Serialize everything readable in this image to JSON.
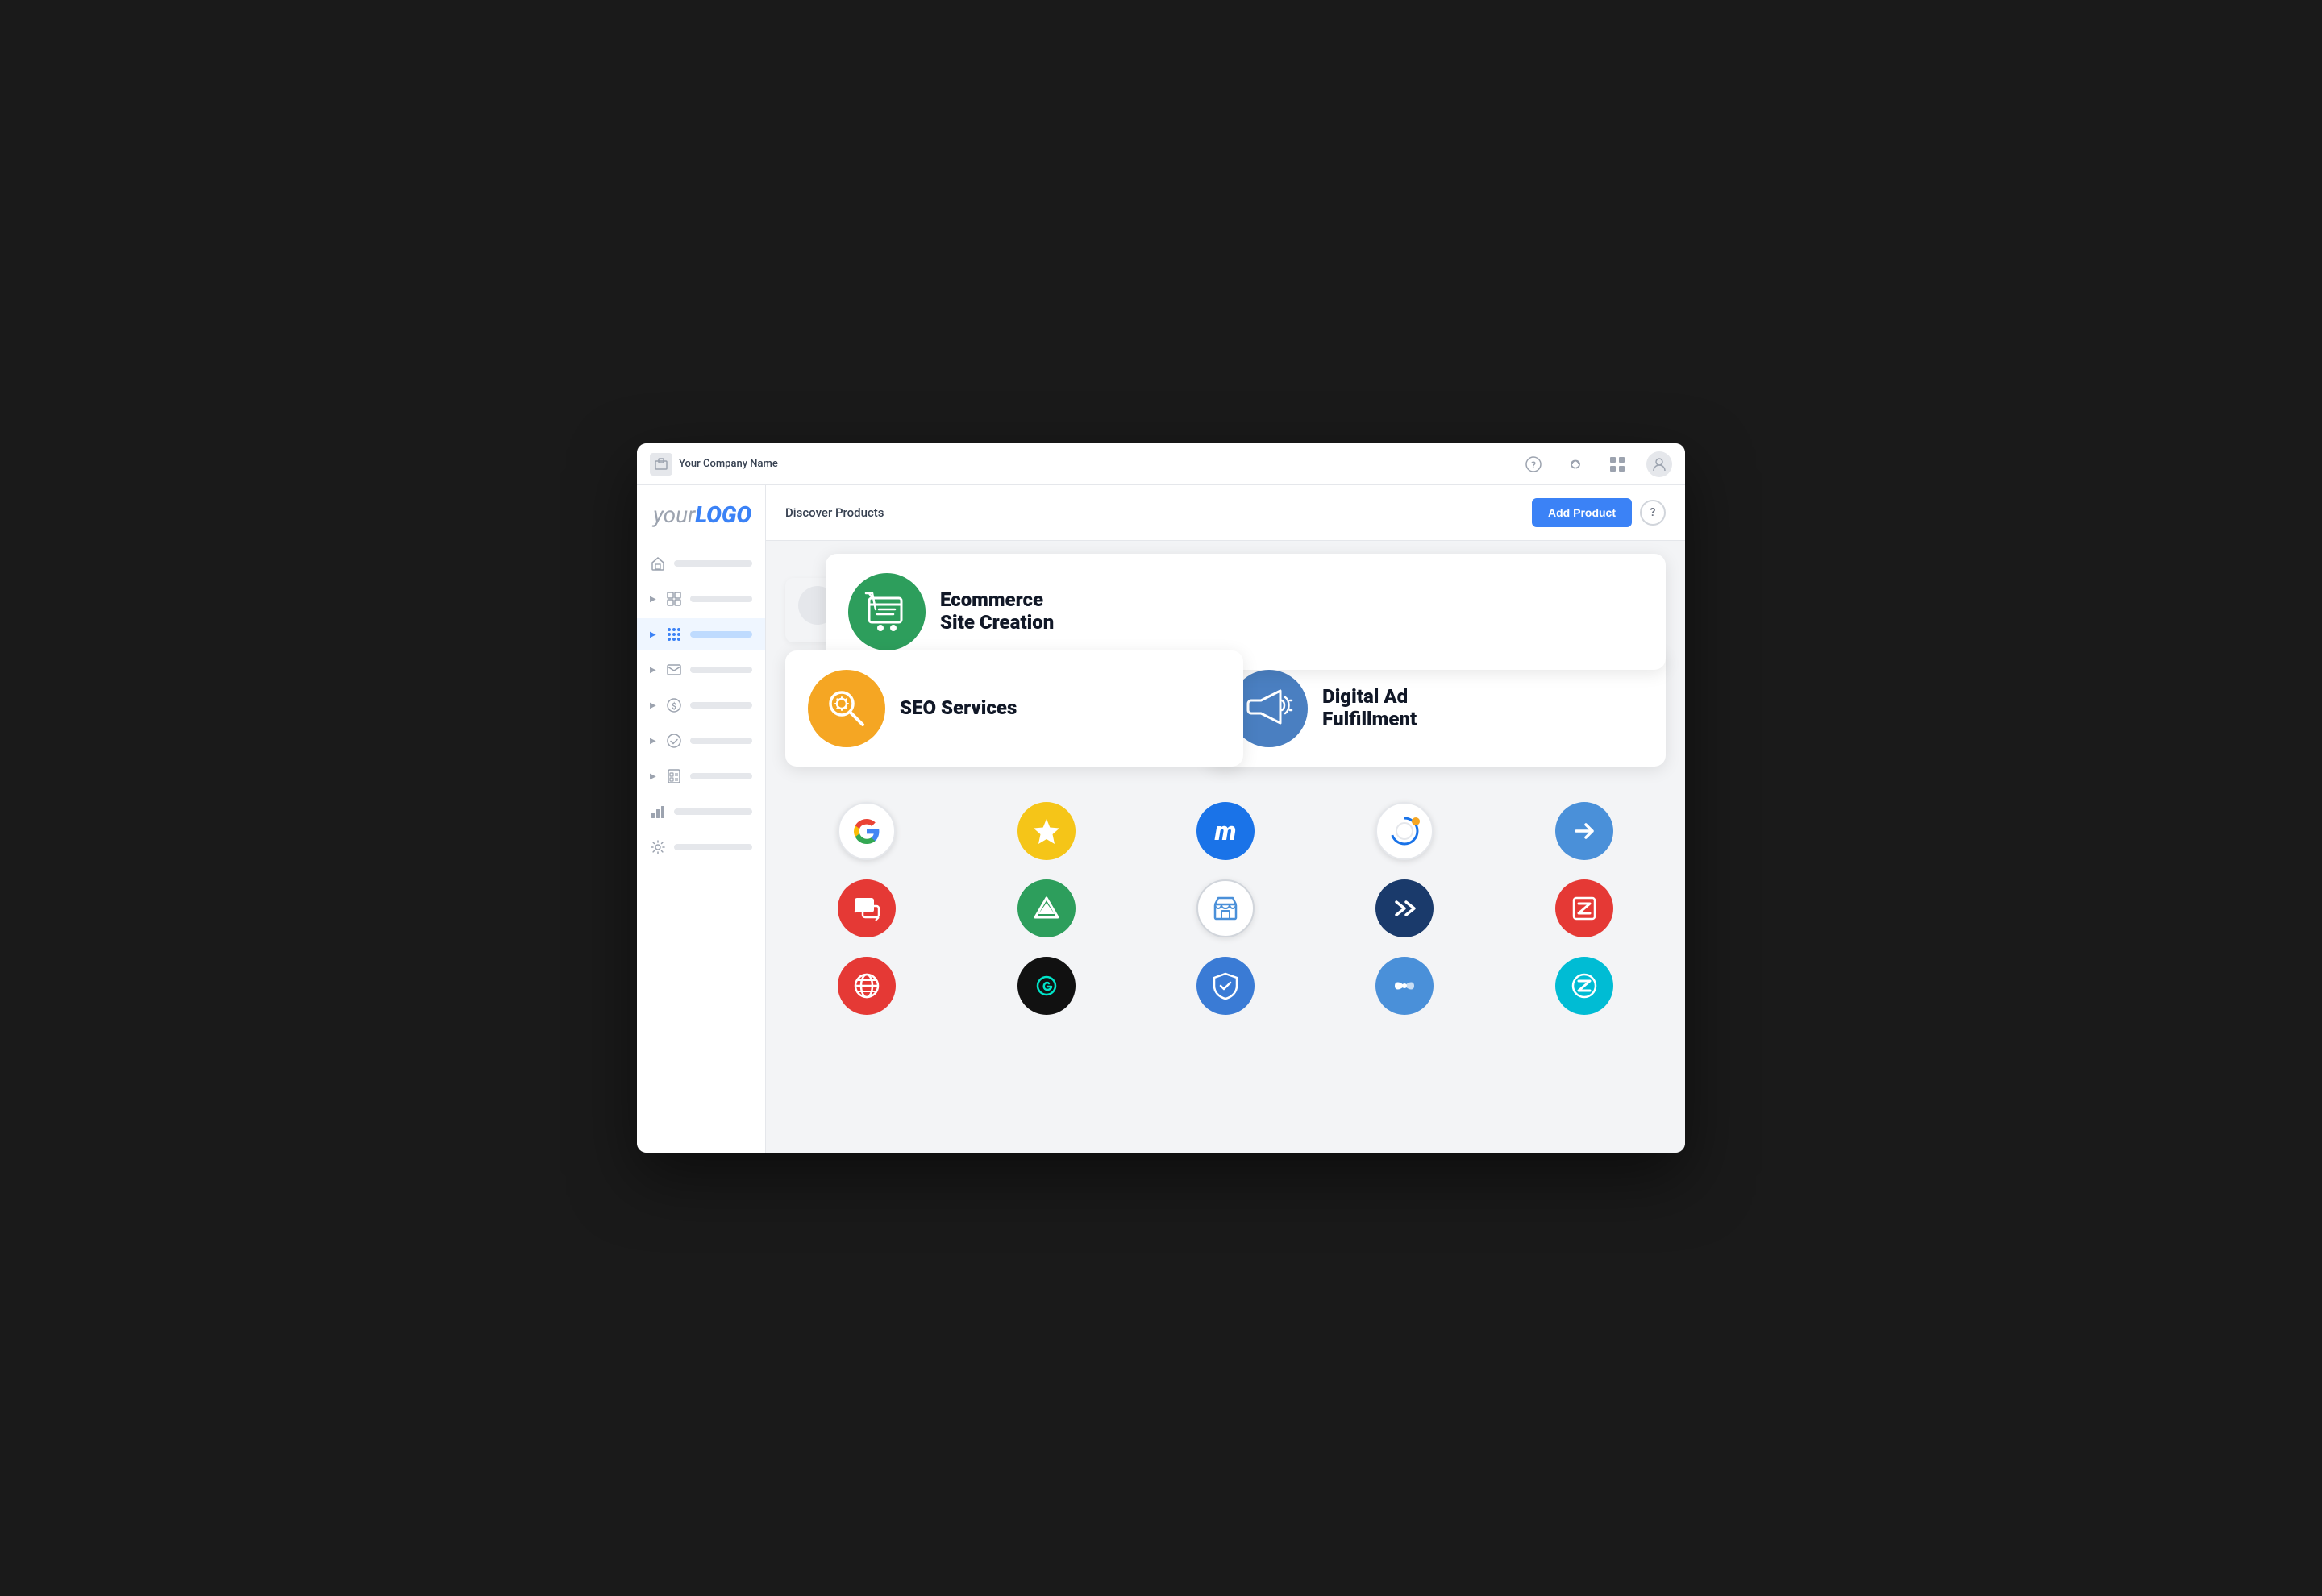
{
  "topBar": {
    "companyName": "Your Company Name",
    "companyIconSymbol": "🏢",
    "icons": {
      "help": "?",
      "infinity": "∞",
      "grid": "⠿",
      "user": "👤"
    }
  },
  "sidebar": {
    "logo": {
      "your": "your",
      "logo": "LOGO"
    },
    "items": [
      {
        "id": "home",
        "icon": "🏠",
        "hasArrow": false,
        "active": false
      },
      {
        "id": "grid1",
        "icon": "⊞",
        "hasArrow": true,
        "active": false
      },
      {
        "id": "apps",
        "icon": "⠿",
        "hasArrow": true,
        "active": true
      },
      {
        "id": "mail",
        "icon": "✉",
        "hasArrow": true,
        "active": false
      },
      {
        "id": "dollar",
        "icon": "$",
        "hasArrow": true,
        "active": false
      },
      {
        "id": "check",
        "icon": "✓",
        "hasArrow": true,
        "active": false
      },
      {
        "id": "report",
        "icon": "▦",
        "hasArrow": true,
        "active": false
      },
      {
        "id": "chart",
        "icon": "📊",
        "hasArrow": false,
        "active": false
      },
      {
        "id": "settings",
        "icon": "⚙",
        "hasArrow": false,
        "active": false
      }
    ]
  },
  "header": {
    "discoverLabel": "Discover Products",
    "addProductBtn": "Add Product",
    "helpBtn": "?"
  },
  "featuredProducts": [
    {
      "id": "ecommerce",
      "title": "Ecommerce\nSite Creation",
      "iconColor": "#2d9e5c",
      "iconType": "cart"
    },
    {
      "id": "seo",
      "title": "SEO Services",
      "iconColor": "#f5a623",
      "iconType": "search-gear"
    },
    {
      "id": "digital-ad",
      "title": "Digital Ad\nFulfillment",
      "iconColor": "#4a7fc1",
      "iconType": "megaphone"
    }
  ],
  "dots": [
    "active",
    "",
    "",
    "",
    ""
  ],
  "serviceIcons": [
    {
      "id": "google",
      "color": "#fff",
      "bg": "#fff",
      "border": "2px solid #e5e7eb",
      "letter": "G",
      "letterColor": "#4285f4",
      "type": "google"
    },
    {
      "id": "star-yellow",
      "color": "#fff",
      "bg": "#f5c518",
      "type": "star"
    },
    {
      "id": "moz",
      "color": "#fff",
      "bg": "#1a73e8",
      "type": "m-circle"
    },
    {
      "id": "circle-orange",
      "color": "#fff",
      "bg": "#fff",
      "type": "ci-orange"
    },
    {
      "id": "arrow-blue",
      "color": "#fff",
      "bg": "#4a90d9",
      "type": "arrow-circle"
    },
    {
      "id": "chat-red",
      "color": "#fff",
      "bg": "#e53935",
      "type": "chat"
    },
    {
      "id": "triangle-green",
      "color": "#fff",
      "bg": "#2d9e5c",
      "type": "triangle"
    },
    {
      "id": "store-blue",
      "color": "#fff",
      "bg": "#fff",
      "border": "2px solid #d1d5db",
      "type": "store"
    },
    {
      "id": "chevron-blue",
      "color": "#fff",
      "bg": "#1a73e8",
      "type": "chevron"
    },
    {
      "id": "z-red",
      "color": "#fff",
      "bg": "#e53935",
      "type": "z-box"
    },
    {
      "id": "globe-red",
      "color": "#fff",
      "bg": "#e53935",
      "type": "globe"
    },
    {
      "id": "g-black",
      "color": "#00e5c9",
      "bg": "#111",
      "type": "g-script"
    },
    {
      "id": "shield-blue",
      "color": "#fff",
      "bg": "#3a7bd5",
      "type": "shield"
    },
    {
      "id": "exchange-blue",
      "color": "#fff",
      "bg": "#4a90d9",
      "type": "exchange"
    },
    {
      "id": "z-teal",
      "color": "#fff",
      "bg": "#00bcd4",
      "type": "z-teal"
    }
  ]
}
